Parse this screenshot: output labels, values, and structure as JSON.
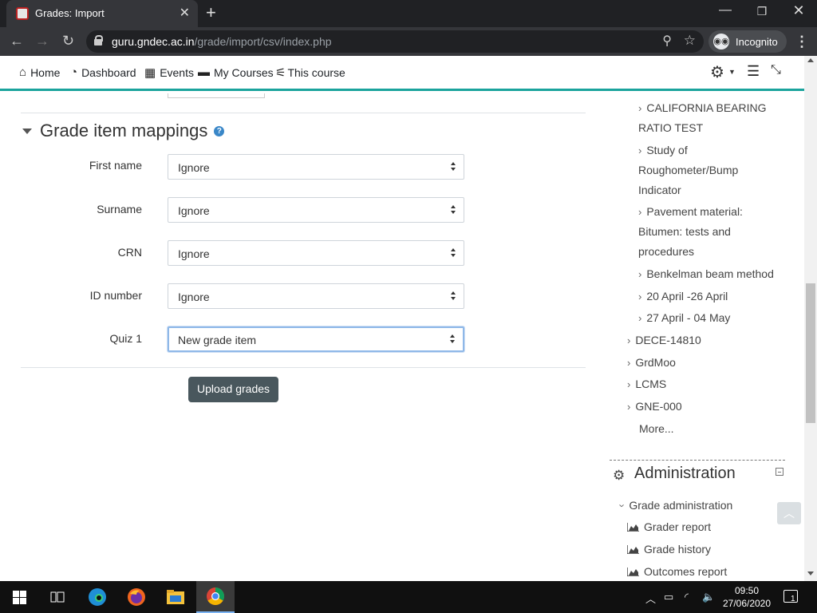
{
  "browser": {
    "tab_title": "Grades: Import",
    "url_domain": "guru.gndec.ac.in",
    "url_path": "/grade/import/csv/index.php",
    "incognito_label": "Incognito"
  },
  "navbar": {
    "items": [
      {
        "label": "Home",
        "icon": "home-icon"
      },
      {
        "label": "Dashboard",
        "icon": "dashboard-icon"
      },
      {
        "label": "Events",
        "icon": "calendar-icon"
      },
      {
        "label": "My Courses",
        "icon": "briefcase-icon"
      },
      {
        "label": "This course",
        "icon": "sitemap-icon"
      }
    ]
  },
  "form": {
    "section_title": "Grade item mappings",
    "fields": [
      {
        "label": "First name",
        "value": "Ignore"
      },
      {
        "label": "Surname",
        "value": "Ignore"
      },
      {
        "label": "CRN",
        "value": "Ignore"
      },
      {
        "label": "ID number",
        "value": "Ignore"
      },
      {
        "label": "Quiz 1",
        "value": "New grade item"
      }
    ],
    "submit_label": "Upload grades"
  },
  "sidebar": {
    "tree_items": [
      "CALIFORNIA BEARING RATIO TEST",
      "Study of Roughometer/Bump Indicator",
      "Pavement material: Bitumen: tests and procedures",
      "Benkelman beam method",
      "20 April -26 April",
      "27 April - 04 May"
    ],
    "courses": [
      "DECE-14810",
      "GrdMoo",
      "LCMS",
      "GNE-000"
    ],
    "more_label": "More...",
    "admin_title": "Administration",
    "grade_admin_label": "Grade administration",
    "reports": [
      "Grader report",
      "Grade history",
      "Outcomes report"
    ]
  },
  "taskbar": {
    "time": "09:50",
    "date": "27/06/2020",
    "notifications": "1"
  }
}
